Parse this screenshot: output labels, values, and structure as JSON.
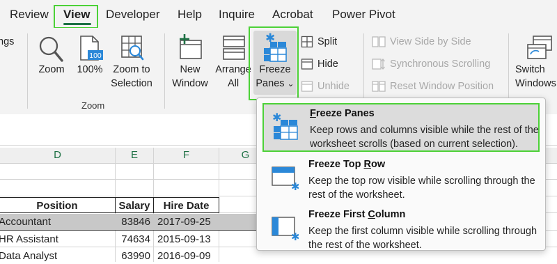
{
  "tabs": {
    "review": "Review",
    "view": "View",
    "developer": "Developer",
    "help": "Help",
    "inquire": "Inquire",
    "acrobat": "Acrobat",
    "power_pivot": "Power Pivot"
  },
  "ribbon": {
    "cut_off_left": "ngs",
    "zoom": "Zoom",
    "zoom_100": "100%",
    "zoom_100_icon_text": "100",
    "zoom_to_selection_line1": "Zoom to",
    "zoom_to_selection_line2": "Selection",
    "zoom_group_label": "Zoom",
    "new_window_line1": "New",
    "new_window_line2": "Window",
    "arrange_all_line1": "Arrange",
    "arrange_all_line2": "All",
    "freeze_panes_line1": "Freeze",
    "freeze_panes_line2": "Panes",
    "freeze_panes_chevron": "⌄",
    "split": "Split",
    "hide": "Hide",
    "unhide": "Unhide",
    "view_side_by_side": "View Side by Side",
    "synchronous_scrolling": "Synchronous Scrolling",
    "reset_window_position": "Reset Window Position",
    "switch_windows_line1": "Switch",
    "switch_windows_line2": "Windows"
  },
  "columns": [
    "D",
    "E",
    "F",
    "G"
  ],
  "table": {
    "headers": [
      "Position",
      "Salary",
      "Hire Date"
    ],
    "rows": [
      [
        "Accountant",
        "83846",
        "2017-09-25"
      ],
      [
        "HR Assistant",
        "74634",
        "2015-09-13"
      ],
      [
        "Data Analyst",
        "63990",
        "2016-09-09"
      ]
    ]
  },
  "menu": {
    "items": [
      {
        "title_key": "F",
        "title_rest": "reeze Panes",
        "description": "Keep rows and columns visible while the rest of the worksheet scrolls (based on current selection)."
      },
      {
        "title_pre": "Freeze Top ",
        "title_key": "R",
        "title_rest": "ow",
        "description": "Keep the top row visible while scrolling through the rest of the worksheet."
      },
      {
        "title_pre": "Freeze First ",
        "title_key": "C",
        "title_rest": "olumn",
        "description": "Keep the first column visible while scrolling through the rest of the worksheet."
      }
    ]
  },
  "colors": {
    "highlight": "#4cd137",
    "excel_green": "#1e7145",
    "icon_blue": "#2b88d8",
    "selected_row": "#c8c8c8"
  },
  "icons": {
    "zoom": "magnifier-icon",
    "zoom_100": "page-100-icon",
    "zoom_selection": "zoom-selection-icon",
    "new_window": "new-window-icon",
    "arrange_all": "arrange-all-icon",
    "freeze_panes": "freeze-panes-icon",
    "freeze_top_row": "freeze-top-row-icon",
    "freeze_first_column": "freeze-first-column-icon"
  }
}
